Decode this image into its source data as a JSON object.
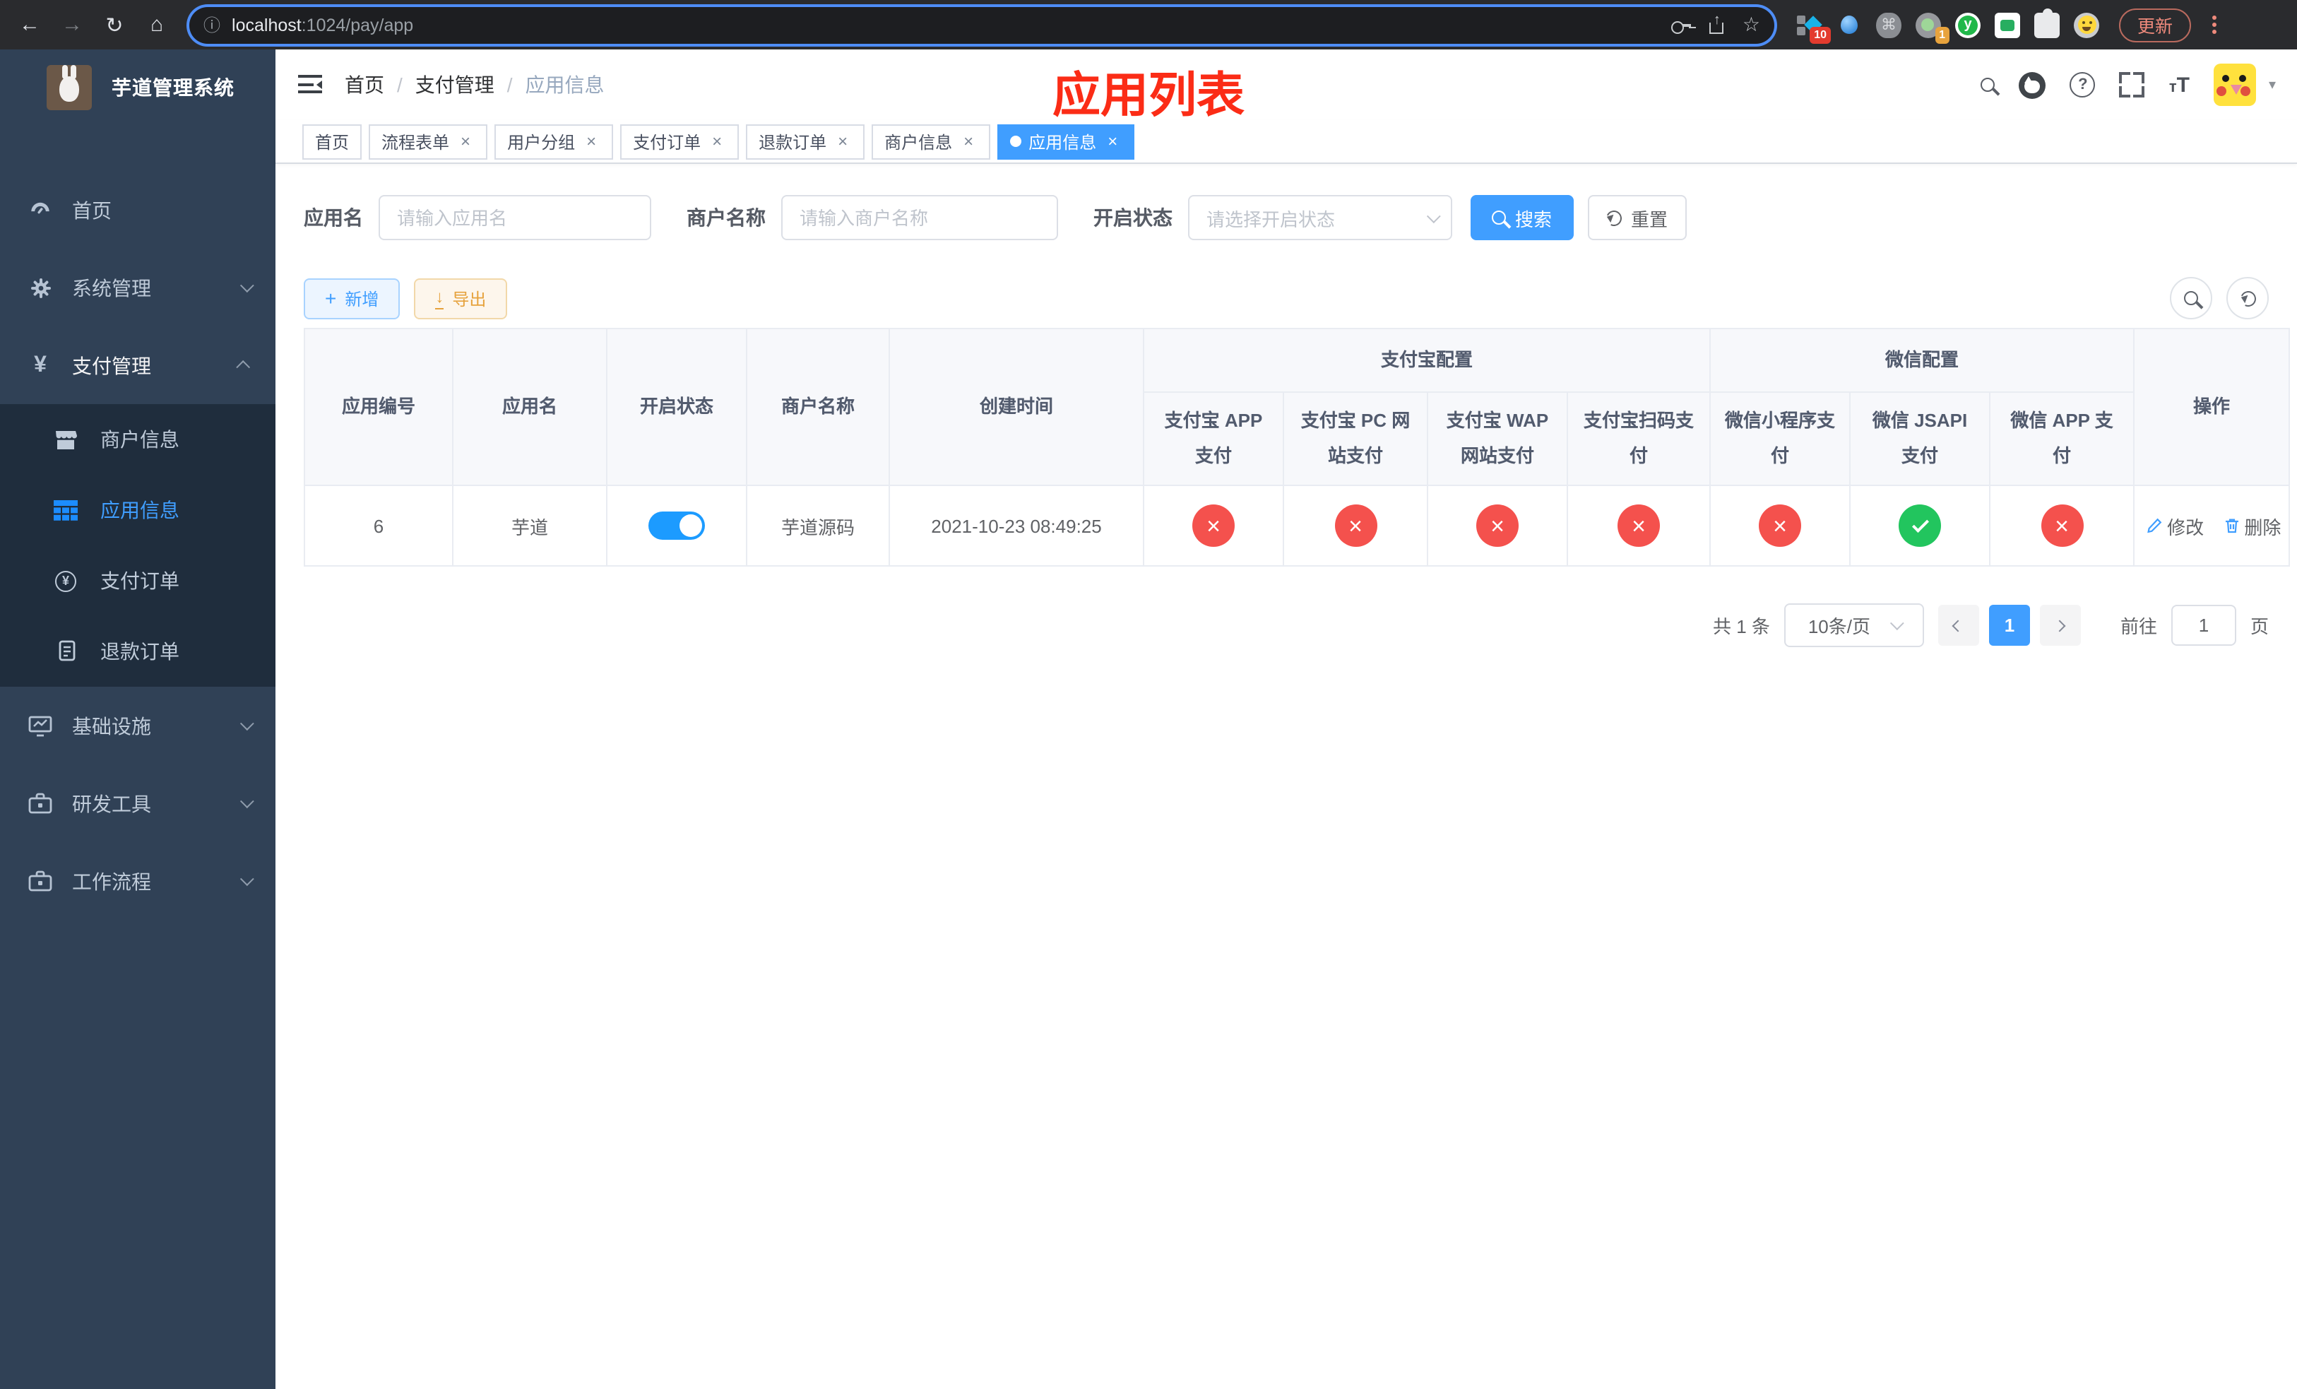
{
  "browser": {
    "url_host": "localhost",
    "url_path": ":1024/pay/app",
    "update_label": "更新",
    "ext_badge_blocks": "10",
    "ext_badge_profile": "1",
    "ext_letter": "y"
  },
  "glyphs": {
    "back": "←",
    "forward": "→",
    "reload": "↻",
    "home": "⌂",
    "info": "ⓘ",
    "star": "☆",
    "command": "⌘",
    "caret_down": "▾",
    "close": "×",
    "cross": "×",
    "plus": "+",
    "download": "↓",
    "question": "?",
    "t_small": "т",
    "t_big": "T",
    "yen": "¥",
    "active_dot": "",
    "breadcrumb_sep": "/"
  },
  "colors": {
    "primary": "#409eff",
    "success": "#22c55e",
    "danger": "#f4514d",
    "warning": "#e6a23c",
    "annotation": "#fb2c16",
    "sidebar": "#304156",
    "submenu": "#1f2d3d"
  },
  "sidebar": {
    "title": "芋道管理系统",
    "items": [
      {
        "label": "首页"
      },
      {
        "label": "系统管理"
      },
      {
        "label": "支付管理"
      },
      {
        "label": "商户信息"
      },
      {
        "label": "应用信息"
      },
      {
        "label": "支付订单"
      },
      {
        "label": "退款订单"
      },
      {
        "label": "基础设施"
      },
      {
        "label": "研发工具"
      },
      {
        "label": "工作流程"
      }
    ]
  },
  "header": {
    "breadcrumb": [
      "首页",
      "支付管理",
      "应用信息"
    ],
    "annotation": "应用列表"
  },
  "tabs": [
    {
      "label": "首页",
      "closable": false,
      "active": false
    },
    {
      "label": "流程表单",
      "closable": true,
      "active": false
    },
    {
      "label": "用户分组",
      "closable": true,
      "active": false
    },
    {
      "label": "支付订单",
      "closable": true,
      "active": false
    },
    {
      "label": "退款订单",
      "closable": true,
      "active": false
    },
    {
      "label": "商户信息",
      "closable": true,
      "active": false
    },
    {
      "label": "应用信息",
      "closable": true,
      "active": true
    }
  ],
  "filters": {
    "app_name_label": "应用名",
    "app_name_placeholder": "请输入应用名",
    "merchant_label": "商户名称",
    "merchant_placeholder": "请输入商户名称",
    "status_label": "开启状态",
    "status_placeholder": "请选择开启状态",
    "search_label": "搜索",
    "reset_label": "重置"
  },
  "toolbar": {
    "add_label": "新增",
    "export_label": "导出"
  },
  "table": {
    "simple_headers": [
      "应用编号",
      "应用名",
      "开启状态",
      "商户名称",
      "创建时间"
    ],
    "groups": [
      {
        "label": "支付宝配置",
        "children": [
          "支付宝 APP 支付",
          "支付宝 PC 网站支付",
          "支付宝 WAP 网站支付",
          "支付宝扫码支付"
        ]
      },
      {
        "label": "微信配置",
        "children": [
          "微信小程序支付",
          "微信 JSAPI 支付",
          "微信 APP 支付"
        ]
      }
    ],
    "action_header": "操作",
    "row": {
      "id": "6",
      "name": "芋道",
      "enabled": true,
      "merchant": "芋道源码",
      "created": "2021-10-23 08:49:25",
      "statuses": [
        "no",
        "no",
        "no",
        "no",
        "no",
        "yes",
        "no"
      ],
      "actions": [
        "修改",
        "删除"
      ]
    }
  },
  "pagination": {
    "total": "共 1 条",
    "page_size": "10条/页",
    "current": "1",
    "goto_label": "前往",
    "goto_value": "1",
    "unit_label": "页"
  }
}
